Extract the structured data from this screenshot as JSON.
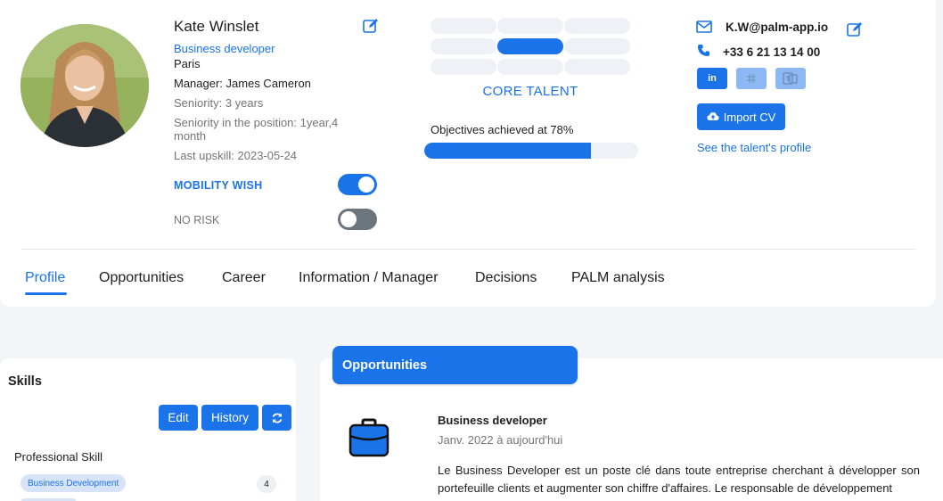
{
  "profile": {
    "name": "Kate Winslet",
    "role": "Business developer",
    "city": "Paris",
    "manager": "Manager: James Cameron",
    "seniority": "Seniority: 3 years",
    "seniority_position": "Seniority in the position: 1year,4 month",
    "last_upskill": "Last upskill: 2023-05-24",
    "mobility_label": "MOBILITY WISH",
    "mobility_on": true,
    "risk_label": "NO RISK",
    "risk_on": false
  },
  "talent": {
    "category": "CORE TALENT",
    "objectives_text": "Objectives achieved at 78%",
    "objectives_percent": 78
  },
  "contact": {
    "email": "K.W@palm-app.io",
    "phone": "+33 6 21 13 14 00",
    "linkedin_label": "in",
    "import_cv_label": "Import CV",
    "see_profile_label": "See the talent's profile"
  },
  "tabs": [
    {
      "label": "Profile",
      "active": true
    },
    {
      "label": "Opportunities"
    },
    {
      "label": "Career"
    },
    {
      "label": "Information / Manager"
    },
    {
      "label": "Decisions"
    },
    {
      "label": "PALM analysis"
    }
  ],
  "skills": {
    "title": "Skills",
    "edit_label": "Edit",
    "history_label": "History",
    "section_label": "Professional Skill",
    "items": [
      {
        "name": "Business Development",
        "count": "4"
      }
    ]
  },
  "opportunities": {
    "header": "Opportunities",
    "items": [
      {
        "title": "Business developer",
        "date": "Janv. 2022 à aujourd'hui",
        "description": "Le Business Developer est un poste clé dans toute entreprise cherchant à développer son portefeuille clients et augmenter son chiffre d'affaires. Le responsable de développement"
      }
    ]
  },
  "colors": {
    "accent": "#1a73e8",
    "toggle_off": "#6c757d",
    "chip_bg": "#d7e4f8"
  },
  "icons": [
    "edit-icon",
    "mail-icon",
    "phone-icon",
    "linkedin-icon",
    "slack-icon",
    "teams-icon",
    "cloud-upload-icon",
    "refresh-icon",
    "briefcase-icon"
  ]
}
